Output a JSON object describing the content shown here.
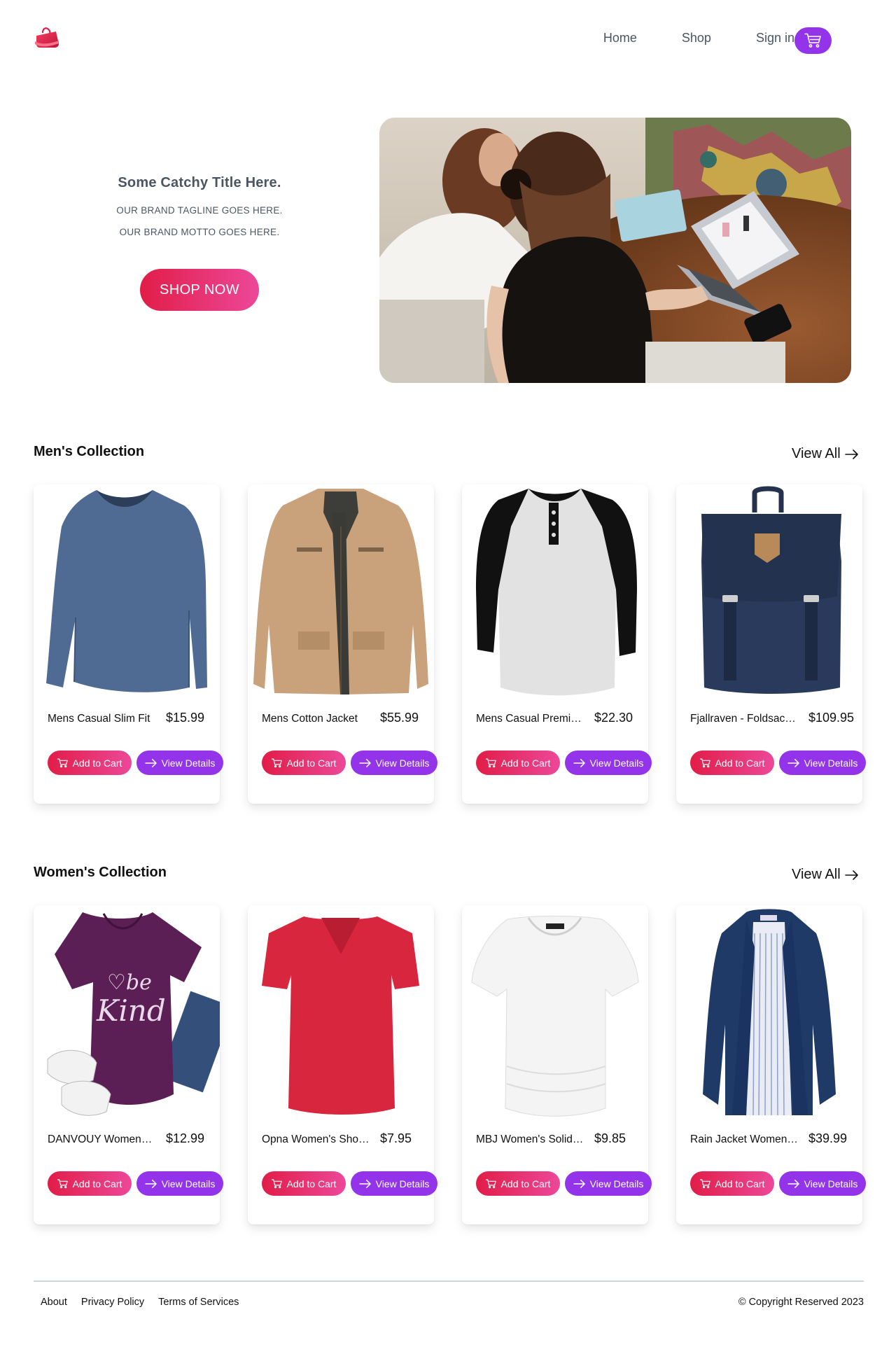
{
  "nav": {
    "links": [
      "Home",
      "Shop",
      "Sign in"
    ]
  },
  "hero": {
    "title": "Some Catchy Title Here.",
    "tagline": "OUR BRAND TAGLINE GOES HERE.",
    "motto": "OUR BRAND MOTTO GOES HERE.",
    "cta": "SHOP NOW"
  },
  "mens": {
    "title": "Men's Collection",
    "view_all": "View All",
    "products": [
      {
        "name": "Mens Casual Slim Fit",
        "price": "$15.99",
        "image": "blue-long-sleeve-shirt"
      },
      {
        "name": "Mens Cotton Jacket",
        "price": "$55.99",
        "image": "tan-cotton-jacket"
      },
      {
        "name": "Mens Casual Premiu...",
        "price": "$22.30",
        "image": "raglan-henley-tee"
      },
      {
        "name": "Fjallraven - Foldsack...",
        "price": "$109.95",
        "image": "navy-backpack"
      }
    ]
  },
  "womens": {
    "title": "Women's Collection",
    "view_all": "View All",
    "products": [
      {
        "name": "DANVOUY Womens T...",
        "price": "$12.99",
        "image": "purple-be-kind-tee"
      },
      {
        "name": "Opna Women's Short Sl...",
        "price": "$7.95",
        "image": "red-vneck-tee"
      },
      {
        "name": "MBJ Women's Solid Sh...",
        "price": "$9.85",
        "image": "white-draped-top"
      },
      {
        "name": "Rain Jacket Women ...",
        "price": "$39.99",
        "image": "navy-rain-jacket"
      }
    ]
  },
  "buttons": {
    "add_to_cart": "Add to Cart",
    "view_details": "View Details"
  },
  "footer": {
    "links": [
      "About",
      "Privacy Policy",
      "Terms of Services"
    ],
    "copyright": "© Copyright Reserved 2023"
  },
  "colors": {
    "accent_purple": "#9333ea",
    "accent_red": "#e11d48",
    "accent_pink": "#ec4899"
  }
}
